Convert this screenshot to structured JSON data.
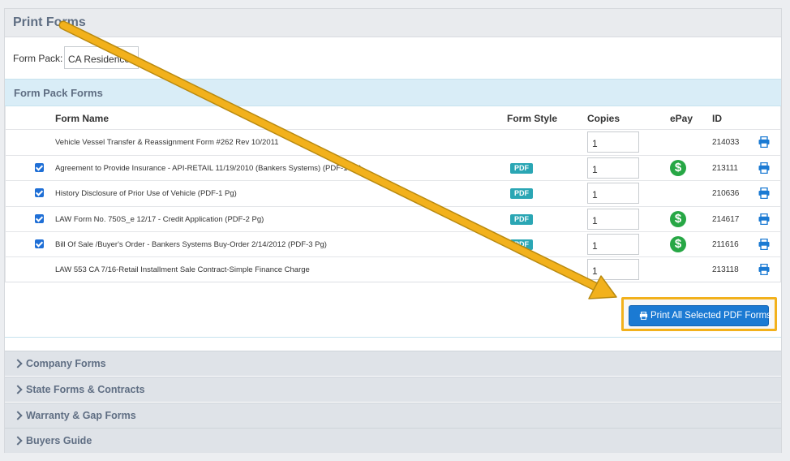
{
  "panel": {
    "title": "Print Forms"
  },
  "form_pack": {
    "label": "Form Pack:",
    "value": "CA Residence"
  },
  "section": {
    "title": "Form Pack Forms"
  },
  "table": {
    "headers": {
      "name": "Form Name",
      "style": "Form Style",
      "copies": "Copies",
      "epay": "ePay",
      "id": "ID"
    },
    "rows": [
      {
        "checked": false,
        "name": "Vehicle Vessel Transfer & Reassignment Form #262 Rev 10/2011",
        "style": "",
        "copies": "1",
        "epay": false,
        "id": "214033"
      },
      {
        "checked": true,
        "name": "Agreement to Provide Insurance - API-RETAIL 11/19/2010 (Bankers Systems) (PDF-1 Pg)",
        "style": "PDF",
        "copies": "1",
        "epay": true,
        "id": "213111"
      },
      {
        "checked": true,
        "name": "History Disclosure of Prior Use of Vehicle (PDF-1 Pg)",
        "style": "PDF",
        "copies": "1",
        "epay": false,
        "id": "210636"
      },
      {
        "checked": true,
        "name": "LAW Form No. 750S_e 12/17 - Credit Application (PDF-2 Pg)",
        "style": "PDF",
        "copies": "1",
        "epay": true,
        "id": "214617"
      },
      {
        "checked": true,
        "name": "Bill Of Sale /Buyer's Order - Bankers Systems Buy-Order 2/14/2012 (PDF-3 Pg)",
        "style": "PDF",
        "copies": "1",
        "epay": true,
        "id": "211616"
      },
      {
        "checked": false,
        "name": "LAW 553 CA 7/16-Retail Installment Sale Contract-Simple Finance Charge",
        "style": "",
        "copies": "1",
        "epay": false,
        "id": "213118"
      }
    ],
    "epay_symbol": "$"
  },
  "print_button": {
    "label": "Print All Selected PDF Forms"
  },
  "accordions": [
    {
      "label": "Company Forms"
    },
    {
      "label": "State Forms & Contracts"
    },
    {
      "label": "Warranty & Gap Forms"
    },
    {
      "label": "Buyers Guide"
    }
  ],
  "colors": {
    "accent": "#1b7ad3",
    "highlight": "#f2b11c",
    "epay": "#27a745",
    "badge": "#2aa6b4"
  }
}
